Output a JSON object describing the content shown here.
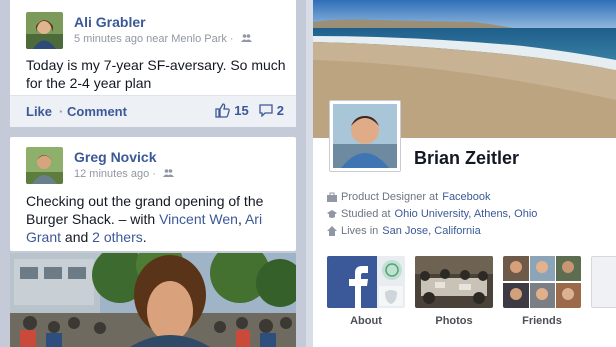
{
  "feed": {
    "posts": [
      {
        "author": "Ali Grabler",
        "meta": "5 minutes ago near Menlo Park ·",
        "text": "Today is my 7-year SF-aversary. So much for the 2-4 year plan",
        "actions": {
          "like": "Like",
          "separator": "·",
          "comment": "Comment"
        },
        "likes": "15",
        "comments": "2"
      },
      {
        "author": "Greg Novick",
        "meta": "12 minutes ago ·",
        "text_prefix": "Checking out the grand opening of the Burger Shack. – with ",
        "tag1": "Vincent Wen",
        "sep": ", ",
        "tag2": "Ari Grant",
        "and": " and ",
        "tag3": "2 others",
        "end": "."
      }
    ]
  },
  "profile": {
    "name": "Brian Zeitler",
    "work_prefix": "Product Designer at ",
    "work_link": "Facebook",
    "study_prefix": "Studied at ",
    "study_link": "Ohio University, Athens, Ohio",
    "lives_prefix": "Lives in ",
    "lives_link": "San Jose, California",
    "tiles": [
      "About",
      "Photos",
      "Friends"
    ]
  },
  "colors": {
    "brand": "#3b5998",
    "text": "#141823",
    "meta": "#9197a3"
  },
  "icons": [
    "friends-icon",
    "like-icon",
    "comment-icon",
    "briefcase-icon",
    "graduation-cap-icon",
    "house-icon"
  ]
}
